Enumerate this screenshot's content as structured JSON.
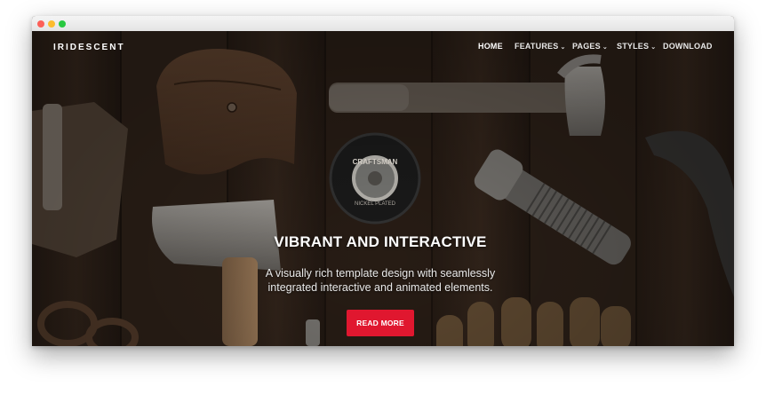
{
  "window": {
    "controls": [
      "close",
      "minimize",
      "zoom"
    ]
  },
  "header": {
    "brand": "IRIDESCENT",
    "nav": [
      {
        "label": "HOME",
        "active": true,
        "dropdown": false
      },
      {
        "label": "FEATURES",
        "active": false,
        "dropdown": true
      },
      {
        "label": "PAGES",
        "active": false,
        "dropdown": true
      },
      {
        "label": "STYLES",
        "active": false,
        "dropdown": true
      },
      {
        "label": "DOWNLOAD",
        "active": false,
        "dropdown": false
      }
    ],
    "chevron_glyph": "⌄"
  },
  "hero": {
    "background_description_icon": "tools-on-wood-photo",
    "headline": "VIBRANT AND INTERACTIVE",
    "subtitle_line1": "A visually rich template design with seamlessly",
    "subtitle_line2": "integrated interactive and animated elements.",
    "cta_label": "READ MORE",
    "tape_label": "CRAFTSMAN",
    "tape_label2": "NICKEL PLATED"
  },
  "colors": {
    "accent": "#e0172f",
    "wood": "#2d2119",
    "text": "#ffffff"
  }
}
